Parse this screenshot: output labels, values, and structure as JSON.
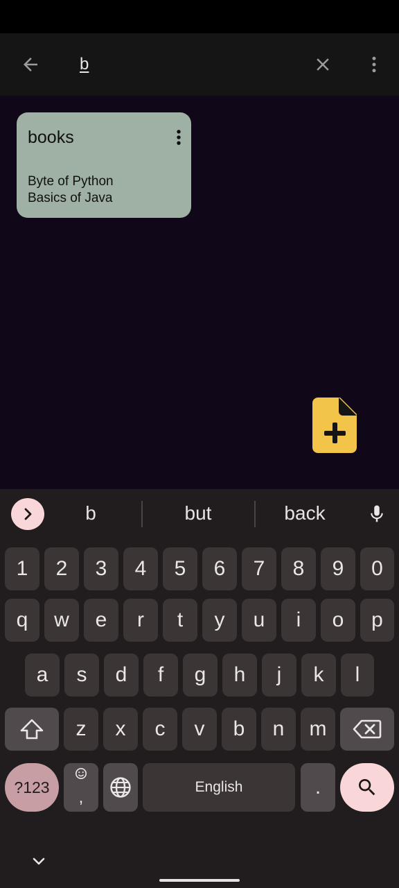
{
  "search": {
    "query": "b"
  },
  "notes": [
    {
      "title": "books",
      "lines": [
        "Byte of Python",
        "Basics of Java"
      ]
    }
  ],
  "keyboard": {
    "suggestions": [
      "b",
      "but",
      "back"
    ],
    "row_numbers": [
      "1",
      "2",
      "3",
      "4",
      "5",
      "6",
      "7",
      "8",
      "9",
      "0"
    ],
    "row1": [
      "q",
      "w",
      "e",
      "r",
      "t",
      "y",
      "u",
      "i",
      "o",
      "p"
    ],
    "row2": [
      "a",
      "s",
      "d",
      "f",
      "g",
      "h",
      "j",
      "k",
      "l"
    ],
    "row3": [
      "z",
      "x",
      "c",
      "v",
      "b",
      "n",
      "m"
    ],
    "symbols_label": "?123",
    "comma_label": ",",
    "space_label": "English",
    "period_label": "."
  },
  "colors": {
    "note_card": "#9fb0a4",
    "fab": "#f2c54a",
    "accent_pink": "#f9d7d9",
    "background": "#100818"
  },
  "icons": {
    "back": "arrow-left-icon",
    "clear": "close-icon",
    "more": "more-vert-icon",
    "fab": "note-add-icon",
    "mic": "mic-icon",
    "shift": "shift-icon",
    "backspace": "backspace-icon",
    "globe": "globe-icon",
    "emoji": "emoji-icon",
    "search": "search-icon"
  }
}
